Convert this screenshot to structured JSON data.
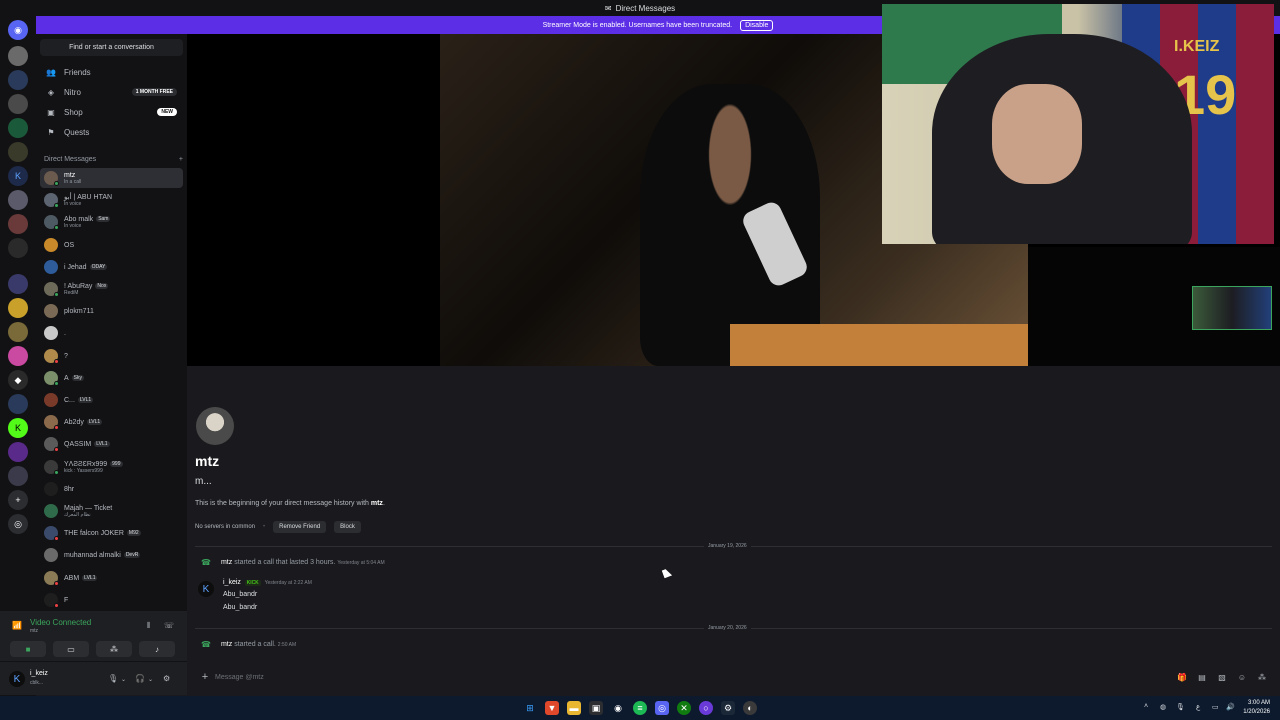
{
  "window": {
    "title": "Direct Messages"
  },
  "banner": {
    "text": "Streamer Mode is enabled. Usernames have been truncated.",
    "button": "Disable"
  },
  "sidebar": {
    "find_label": "Find or start a conversation",
    "nav": [
      {
        "label": "Friends",
        "icon": "friends-icon"
      },
      {
        "label": "Nitro",
        "icon": "nitro-icon",
        "badge": "1 MONTH FREE"
      },
      {
        "label": "Shop",
        "icon": "shop-icon",
        "badge": "NEW"
      },
      {
        "label": "Quests",
        "icon": "quests-icon"
      }
    ],
    "dm_header": "Direct Messages",
    "dms": [
      {
        "name": "mtz",
        "sub": "In a call",
        "color": "#6b5a4e",
        "status": "#3ba55d"
      },
      {
        "name": "أبو | ABU HTAN",
        "sub": "In voice",
        "color": "#5b6470",
        "status": "#3ba55d"
      },
      {
        "name": "Abo malk",
        "tag": "Sam",
        "sub": "In voice",
        "color": "#4e5a63",
        "status": "#3ba55d"
      },
      {
        "name": "OS",
        "sub": "",
        "color": "#c7892a",
        "status": ""
      },
      {
        "name": "i Jehad",
        "tag": "ODAY",
        "sub": "",
        "color": "#2e5b9a",
        "status": ""
      },
      {
        "name": "! AbuRay",
        "tag": "Nox",
        "sub": "RediM",
        "color": "#6d6a5a",
        "status": "#3ba55d"
      },
      {
        "name": "plokm711",
        "sub": "",
        "color": "#7a6a55",
        "status": ""
      },
      {
        "name": ".",
        "sub": "",
        "color": "#c9c9c9",
        "status": ""
      },
      {
        "name": "?",
        "sub": "",
        "color": "#b08a4a",
        "status": "#ed4245"
      },
      {
        "name": "A",
        "tag": "Sky",
        "sub": "",
        "color": "#7a8f6a",
        "status": "#3ba55d"
      },
      {
        "name": "C...",
        "tag": "LVL1",
        "sub": "",
        "color": "#7a3a2a",
        "status": ""
      },
      {
        "name": "Ab2dy",
        "tag": "LVL1",
        "sub": "",
        "color": "#8a6a4a",
        "status": "#ed4245"
      },
      {
        "name": "QASSIM",
        "tag": "LVL1",
        "sub": "",
        "color": "#5a5a5a",
        "status": "#ed4245"
      },
      {
        "name": "YΛƧƧƐRx999",
        "tag": "999",
        "sub": "kick : Yassers999",
        "color": "#3a3a3a",
        "status": "#3ba55d"
      },
      {
        "name": "8hr",
        "sub": "",
        "color": "#1e1e1e",
        "status": ""
      },
      {
        "name": "Majah — Ticket",
        "sub": "نظام المعرك",
        "color": "#2f6a4a",
        "status": ""
      },
      {
        "name": "THE falcon JOKER",
        "tag": "M92",
        "sub": "",
        "color": "#3a4a6a",
        "status": "#ed4245"
      },
      {
        "name": "muhannad almalki",
        "tag": "DevR",
        "sub": "",
        "color": "#6a6a6a",
        "status": ""
      },
      {
        "name": "ABM",
        "tag": "LVL1",
        "sub": "",
        "color": "#8a7a55",
        "status": "#ed4245"
      },
      {
        "name": "F",
        "sub": "",
        "color": "#1e1e1e",
        "status": "#ed4245"
      }
    ]
  },
  "voice": {
    "title": "Video Connected",
    "sub": "mtz"
  },
  "user": {
    "name": "i_keiz",
    "sub": "cblk..."
  },
  "profile": {
    "name": "mtz",
    "status": "m...",
    "begin_prefix": "This is the beginning of your direct message history with ",
    "begin_name": "mtz",
    "begin_suffix": ".",
    "servers": "No servers in common",
    "remove_friend": "Remove Friend",
    "block": "Block"
  },
  "messages": {
    "date1": "January 19, 2026",
    "call1_name": "mtz",
    "call1_text": "started a call that lasted 3 hours.",
    "call1_time": "Yesterday at 5:04 AM",
    "author": "i_keiz",
    "author_tag": "KICK",
    "author_time": "Yesterday at 2:22 AM",
    "line1": "Abu_bandr",
    "line2": "Abu_bandr",
    "date2": "January 20, 2026",
    "call2_name": "mtz",
    "call2_text": "started a call.",
    "call2_time": "2:50 AM"
  },
  "composer": {
    "placeholder": "Message @mtz"
  },
  "webcam": {
    "jersey_name": "I.KEIZ",
    "jersey_number": "19"
  },
  "taskbar": {
    "time": "3:00 AM",
    "date": "1/20/2026"
  },
  "colors": {
    "accent": "#5c2ee6",
    "green": "#3ba55d",
    "red": "#ed4245"
  }
}
